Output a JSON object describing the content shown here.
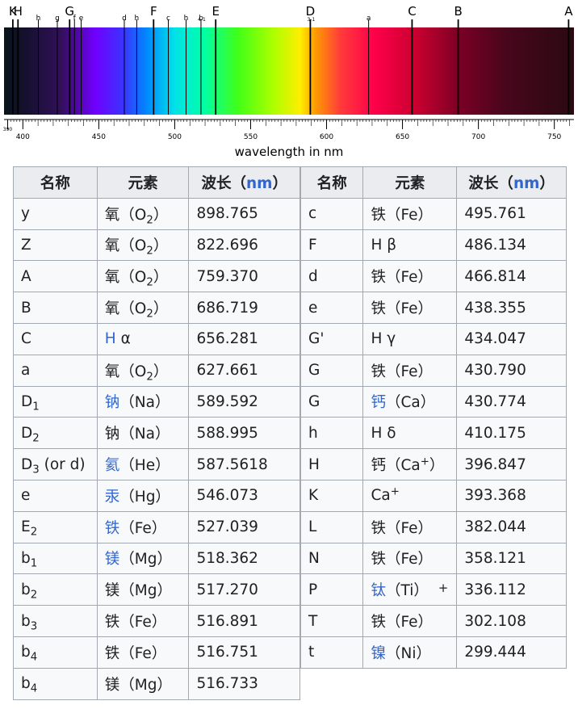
{
  "spectrum": {
    "xlabel": "wavelength in nm",
    "axis_min": 390,
    "axis_max": 760,
    "ticks": [
      390,
      400,
      450,
      500,
      550,
      600,
      650,
      700,
      750
    ],
    "tick_labels": [
      "390",
      "400",
      "450",
      "500",
      "550",
      "600",
      "650",
      "700",
      "750"
    ],
    "lines": [
      {
        "label": "K",
        "wl": 393.4,
        "size": "big"
      },
      {
        "label": "H",
        "wl": 396.8,
        "size": "big"
      },
      {
        "label": "h",
        "wl": 410.2,
        "size": "small"
      },
      {
        "label": "g",
        "wl": 422.7,
        "size": "small"
      },
      {
        "label": "G",
        "wl": 430.8,
        "size": "big"
      },
      {
        "label": "f",
        "wl": 434.0,
        "size": "small"
      },
      {
        "label": "e",
        "wl": 438.4,
        "size": "small"
      },
      {
        "label": "d",
        "wl": 466.8,
        "size": "small"
      },
      {
        "label": "h",
        "wl": 475.0,
        "size": "small"
      },
      {
        "label": "F",
        "wl": 486.1,
        "size": "big"
      },
      {
        "label": "c",
        "wl": 495.8,
        "size": "small"
      },
      {
        "label": "h",
        "wl": 507.5,
        "size": "small"
      },
      {
        "label": "b",
        "wl": 517.3,
        "size": "small"
      },
      {
        "label": "4-1",
        "wl": 517.3,
        "size": "tiny"
      },
      {
        "label": "E",
        "wl": 527.0,
        "size": "big"
      },
      {
        "label": "D",
        "wl": 589.3,
        "size": "big"
      },
      {
        "label": "3-1",
        "wl": 589.3,
        "size": "tiny"
      },
      {
        "label": "a",
        "wl": 627.7,
        "size": "small"
      },
      {
        "label": "C",
        "wl": 656.3,
        "size": "big"
      },
      {
        "label": "B",
        "wl": 686.7,
        "size": "big"
      },
      {
        "label": "A",
        "wl": 759.4,
        "size": "big"
      }
    ]
  },
  "table": {
    "headers": [
      "名称",
      "元素",
      "波长（",
      "nm",
      "）"
    ],
    "left_rows": [
      {
        "name": "y",
        "name_sub": "",
        "name_tail": "",
        "elem_link": "",
        "elem_char": "氧",
        "elem_rest": "（O",
        "elem_sub": "2",
        "elem_sup": "",
        "elem_end": "）",
        "elem_plus": "",
        "link": false,
        "wl": "898.765"
      },
      {
        "name": "Z",
        "name_sub": "",
        "name_tail": "",
        "elem_char": "氧",
        "elem_rest": "（O",
        "elem_sub": "2",
        "elem_sup": "",
        "elem_end": "）",
        "elem_plus": "",
        "link": false,
        "wl": "822.696"
      },
      {
        "name": "A",
        "name_sub": "",
        "name_tail": "",
        "elem_char": "氧",
        "elem_rest": "（O",
        "elem_sub": "2",
        "elem_sup": "",
        "elem_end": "）",
        "elem_plus": "",
        "link": false,
        "wl": "759.370"
      },
      {
        "name": "B",
        "name_sub": "",
        "name_tail": "",
        "elem_char": "氧",
        "elem_rest": "（O",
        "elem_sub": "2",
        "elem_sup": "",
        "elem_end": "）",
        "elem_plus": "",
        "link": false,
        "wl": "686.719"
      },
      {
        "name": "C",
        "name_sub": "",
        "name_tail": "",
        "elem_char": "H",
        "elem_rest": " α",
        "elem_sub": "",
        "elem_sup": "",
        "elem_end": "",
        "elem_plus": "",
        "link": true,
        "wl": "656.281"
      },
      {
        "name": "a",
        "name_sub": "",
        "name_tail": "",
        "elem_char": "氧",
        "elem_rest": "（O",
        "elem_sub": "2",
        "elem_sup": "",
        "elem_end": "）",
        "elem_plus": "",
        "link": false,
        "wl": "627.661"
      },
      {
        "name": "D",
        "name_sub": "1",
        "name_tail": "",
        "elem_char": "钠",
        "elem_rest": "（Na）",
        "elem_sub": "",
        "elem_sup": "",
        "elem_end": "",
        "elem_plus": "",
        "link": true,
        "wl": "589.592"
      },
      {
        "name": "D",
        "name_sub": "2",
        "name_tail": "",
        "elem_char": "钠",
        "elem_rest": "（Na）",
        "elem_sub": "",
        "elem_sup": "",
        "elem_end": "",
        "elem_plus": "",
        "link": false,
        "wl": "588.995"
      },
      {
        "name": "D",
        "name_sub": "3",
        "name_tail": " (or d)",
        "elem_char": "氦",
        "elem_rest": "（He）",
        "elem_sub": "",
        "elem_sup": "",
        "elem_end": "",
        "elem_plus": "",
        "link": true,
        "wl": "587.5618"
      },
      {
        "name": "e",
        "name_sub": "",
        "name_tail": "",
        "elem_char": "汞",
        "elem_rest": "（Hg）",
        "elem_sub": "",
        "elem_sup": "",
        "elem_end": "",
        "elem_plus": "",
        "link": true,
        "wl": "546.073"
      },
      {
        "name": "E",
        "name_sub": "2",
        "name_tail": "",
        "elem_char": "铁",
        "elem_rest": "（Fe）",
        "elem_sub": "",
        "elem_sup": "",
        "elem_end": "",
        "elem_plus": "",
        "link": true,
        "wl": "527.039"
      },
      {
        "name": "b",
        "name_sub": "1",
        "name_tail": "",
        "elem_char": "镁",
        "elem_rest": "（Mg）",
        "elem_sub": "",
        "elem_sup": "",
        "elem_end": "",
        "elem_plus": "",
        "link": true,
        "wl": "518.362"
      },
      {
        "name": "b",
        "name_sub": "2",
        "name_tail": "",
        "elem_char": "镁",
        "elem_rest": "（Mg）",
        "elem_sub": "",
        "elem_sup": "",
        "elem_end": "",
        "elem_plus": "",
        "link": false,
        "wl": "517.270"
      },
      {
        "name": "b",
        "name_sub": "3",
        "name_tail": "",
        "elem_char": "铁",
        "elem_rest": "（Fe）",
        "elem_sub": "",
        "elem_sup": "",
        "elem_end": "",
        "elem_plus": "",
        "link": false,
        "wl": "516.891"
      },
      {
        "name": "b",
        "name_sub": "4",
        "name_tail": "",
        "elem_char": "铁",
        "elem_rest": "（Fe）",
        "elem_sub": "",
        "elem_sup": "",
        "elem_end": "",
        "elem_plus": "",
        "link": false,
        "wl": "516.751"
      },
      {
        "name": "b",
        "name_sub": "4",
        "name_tail": "",
        "elem_char": "镁",
        "elem_rest": "（Mg）",
        "elem_sub": "",
        "elem_sup": "",
        "elem_end": "",
        "elem_plus": "",
        "link": false,
        "wl": "516.733"
      }
    ],
    "right_rows": [
      {
        "name": "c",
        "name_sub": "",
        "name_tail": "",
        "elem_char": "铁",
        "elem_rest": "（Fe）",
        "elem_sub": "",
        "elem_sup": "",
        "elem_end": "",
        "elem_plus": "",
        "link": false,
        "wl": "495.761"
      },
      {
        "name": "F",
        "name_sub": "",
        "name_tail": "",
        "elem_char": "H",
        "elem_rest": " β",
        "elem_sub": "",
        "elem_sup": "",
        "elem_end": "",
        "elem_plus": "",
        "link": false,
        "wl": "486.134"
      },
      {
        "name": "d",
        "name_sub": "",
        "name_tail": "",
        "elem_char": "铁",
        "elem_rest": "（Fe）",
        "elem_sub": "",
        "elem_sup": "",
        "elem_end": "",
        "elem_plus": "",
        "link": false,
        "wl": "466.814"
      },
      {
        "name": "e",
        "name_sub": "",
        "name_tail": "",
        "elem_char": "铁",
        "elem_rest": "（Fe）",
        "elem_sub": "",
        "elem_sup": "",
        "elem_end": "",
        "elem_plus": "",
        "link": false,
        "wl": "438.355"
      },
      {
        "name": "G'",
        "name_sub": "",
        "name_tail": "",
        "elem_char": "H",
        "elem_rest": " γ",
        "elem_sub": "",
        "elem_sup": "",
        "elem_end": "",
        "elem_plus": "",
        "link": false,
        "wl": "434.047"
      },
      {
        "name": "G",
        "name_sub": "",
        "name_tail": "",
        "elem_char": "铁",
        "elem_rest": "（Fe）",
        "elem_sub": "",
        "elem_sup": "",
        "elem_end": "",
        "elem_plus": "",
        "link": false,
        "wl": "430.790"
      },
      {
        "name": "G",
        "name_sub": "",
        "name_tail": "",
        "elem_char": "钙",
        "elem_rest": "（Ca）",
        "elem_sub": "",
        "elem_sup": "",
        "elem_end": "",
        "elem_plus": "",
        "link": true,
        "wl": "430.774"
      },
      {
        "name": "h",
        "name_sub": "",
        "name_tail": "",
        "elem_char": "H",
        "elem_rest": " δ",
        "elem_sub": "",
        "elem_sup": "",
        "elem_end": "",
        "elem_plus": "",
        "link": false,
        "wl": "410.175"
      },
      {
        "name": "H",
        "name_sub": "",
        "name_tail": "",
        "elem_char": "钙",
        "elem_rest": "（Ca",
        "elem_sub": "",
        "elem_sup": "+",
        "elem_end": "）",
        "elem_plus": "",
        "link": false,
        "wl": "396.847"
      },
      {
        "name": "K",
        "name_sub": "",
        "name_tail": "",
        "elem_char": "Ca",
        "elem_rest": "",
        "elem_sub": "",
        "elem_sup": "+",
        "elem_end": "",
        "elem_plus": "",
        "link": false,
        "wl": "393.368"
      },
      {
        "name": "L",
        "name_sub": "",
        "name_tail": "",
        "elem_char": "铁",
        "elem_rest": "（Fe）",
        "elem_sub": "",
        "elem_sup": "",
        "elem_end": "",
        "elem_plus": "",
        "link": false,
        "wl": "382.044"
      },
      {
        "name": "N",
        "name_sub": "",
        "name_tail": "",
        "elem_char": "铁",
        "elem_rest": "（Fe）",
        "elem_sub": "",
        "elem_sup": "",
        "elem_end": "",
        "elem_plus": "",
        "link": false,
        "wl": "358.121"
      },
      {
        "name": "P",
        "name_sub": "",
        "name_tail": "",
        "elem_char": "钛",
        "elem_rest": "（Ti）",
        "elem_sub": "",
        "elem_sup": "",
        "elem_end": "",
        "elem_plus": "+",
        "link": true,
        "wl": "336.112"
      },
      {
        "name": "T",
        "name_sub": "",
        "name_tail": "",
        "elem_char": "铁",
        "elem_rest": "（Fe）",
        "elem_sub": "",
        "elem_sup": "",
        "elem_end": "",
        "elem_plus": "",
        "link": false,
        "wl": "302.108"
      },
      {
        "name": "t",
        "name_sub": "",
        "name_tail": "",
        "elem_char": "镍",
        "elem_rest": "（Ni）",
        "elem_sub": "",
        "elem_sup": "",
        "elem_end": "",
        "elem_plus": "",
        "link": true,
        "wl": "299.444"
      }
    ]
  }
}
